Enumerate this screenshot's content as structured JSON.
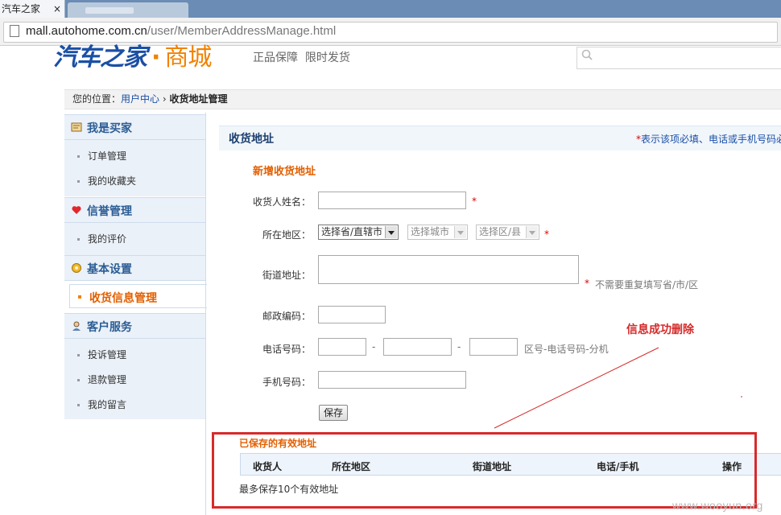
{
  "browser": {
    "active_tab_title": "汽车之家",
    "tab_close": "×",
    "url_host": "mall.autohome.com.cn",
    "url_path": "/user/MemberAddressManage.html"
  },
  "header": {
    "logo_main": "汽车之家",
    "logo_sep": "·",
    "logo_mall": "商城",
    "slogan": "正品保障  限时发货"
  },
  "breadcrumb": {
    "prefix": "您的位置：",
    "link": "用户中心",
    "sep": "›",
    "current": "收货地址管理"
  },
  "sidebar": {
    "sections": [
      {
        "title": "我是买家",
        "icon": "buyer-icon",
        "items": [
          "订单管理",
          "我的收藏夹"
        ]
      },
      {
        "title": "信誉管理",
        "icon": "heart-icon",
        "items": [
          "我的评价"
        ]
      },
      {
        "title": "基本设置",
        "icon": "gear-icon",
        "items": []
      },
      {
        "title": "客户服务",
        "icon": "service-icon",
        "items": [
          "投诉管理",
          "退款管理",
          "我的留言"
        ]
      }
    ],
    "active_item": "收货信息管理"
  },
  "main": {
    "title": "收货地址",
    "note_star": "*",
    "note_text": "表示该项必填、电话或手机号码必",
    "new_title": "新增收货地址",
    "form": {
      "name_label": "收货人姓名：",
      "region_label": "所在地区：",
      "province_value": "选择省/直辖市",
      "city_value": "选择城市",
      "district_value": "选择区/县",
      "street_label": "街道地址：",
      "street_hint": "不需要重复填写省/市/区",
      "zip_label": "邮政编码：",
      "phone_label": "电话号码：",
      "phone_dash": "-",
      "phone_hint": "区号-电话号码-分机",
      "mobile_label": "手机号码：",
      "required_mark": "*",
      "save_label": "保存"
    },
    "annotation": "信息成功删除",
    "saved": {
      "title": "已保存的有效地址",
      "columns": [
        "收货人",
        "所在地区",
        "街道地址",
        "电话/手机",
        "操作"
      ],
      "note": "最多保存10个有效地址"
    }
  },
  "watermark": "www.wooyun.org",
  "colors": {
    "accent": "#e35f00",
    "link": "#1a4fa5",
    "highlight_box": "#d82a2a"
  }
}
